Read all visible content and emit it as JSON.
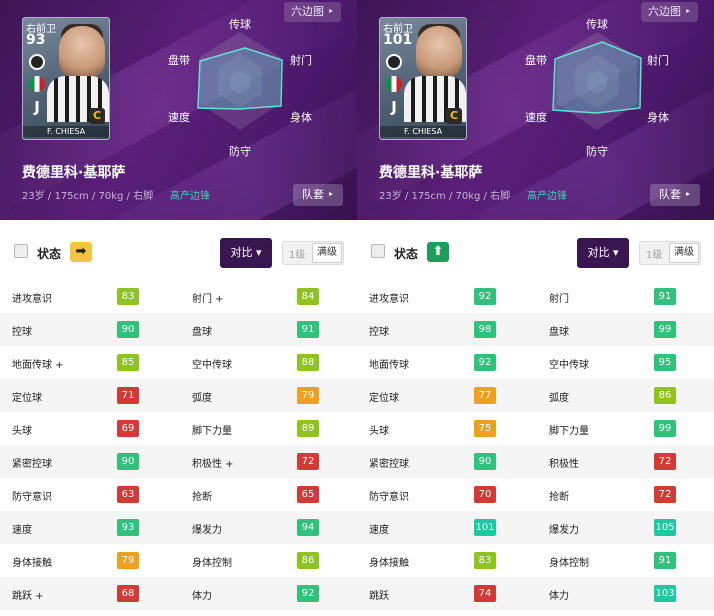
{
  "panels": [
    {
      "card": {
        "position": "右前卫",
        "overall": "93",
        "rating_letter": "C",
        "name": "F. CHIESA"
      },
      "hex_button": "六边图 ‣",
      "radar_labels": {
        "top": "传球",
        "top_right": "射门",
        "bottom_right": "身体",
        "bottom": "防守",
        "bottom_left": "速度",
        "top_left": "盘带"
      },
      "player_name": "费德里科·基耶萨",
      "info": "23岁 / 175cm / 70kg / 右脚",
      "role": "高产边锋",
      "team_button": "队套 ‣",
      "status_label": "状态",
      "status_badge": "➡",
      "compare_button": "对比 ▾",
      "level_low": "1级",
      "level_max": "满级",
      "colors": {
        "status_badge": "#f5c542"
      },
      "stats": [
        {
          "a": "进攻意识",
          "av": "83",
          "b": "射门 +",
          "bv": "84"
        },
        {
          "a": "控球",
          "av": "90",
          "b": "盘球",
          "bv": "91"
        },
        {
          "a": "地面传球 +",
          "av": "85",
          "b": "空中传球",
          "bv": "88"
        },
        {
          "a": "定位球",
          "av": "71",
          "b": "弧度",
          "bv": "79"
        },
        {
          "a": "头球",
          "av": "69",
          "b": "脚下力量",
          "bv": "89"
        },
        {
          "a": "紧密控球",
          "av": "90",
          "b": "积极性 +",
          "bv": "72"
        },
        {
          "a": "防守意识",
          "av": "63",
          "b": "抢断",
          "bv": "65"
        },
        {
          "a": "速度",
          "av": "93",
          "b": "爆发力",
          "bv": "94"
        },
        {
          "a": "身体接触",
          "av": "79",
          "b": "身体控制",
          "bv": "86"
        },
        {
          "a": "跳跃 +",
          "av": "68",
          "b": "体力",
          "bv": "92"
        }
      ]
    },
    {
      "card": {
        "position": "右前卫",
        "overall": "101",
        "rating_letter": "C",
        "name": "F. CHIESA"
      },
      "hex_button": "六边图 ‣",
      "radar_labels": {
        "top": "传球",
        "top_right": "射门",
        "bottom_right": "身体",
        "bottom": "防守",
        "bottom_left": "速度",
        "top_left": "盘带"
      },
      "player_name": "费德里科·基耶萨",
      "info": "23岁 / 175cm / 70kg / 右脚",
      "role": "高产边锋",
      "team_button": "队套 ‣",
      "status_label": "状态",
      "status_badge": "⬆",
      "compare_button": "对比 ▾",
      "level_low": "1级",
      "level_max": "满级",
      "colors": {
        "status_badge": "#1aa05a"
      },
      "stats": [
        {
          "a": "进攻意识",
          "av": "92",
          "b": "射门",
          "bv": "91"
        },
        {
          "a": "控球",
          "av": "98",
          "b": "盘球",
          "bv": "99"
        },
        {
          "a": "地面传球",
          "av": "92",
          "b": "空中传球",
          "bv": "95"
        },
        {
          "a": "定位球",
          "av": "77",
          "b": "弧度",
          "bv": "86"
        },
        {
          "a": "头球",
          "av": "75",
          "b": "脚下力量",
          "bv": "99"
        },
        {
          "a": "紧密控球",
          "av": "90",
          "b": "积极性",
          "bv": "72"
        },
        {
          "a": "防守意识",
          "av": "70",
          "b": "抢断",
          "bv": "72"
        },
        {
          "a": "速度",
          "av": "101",
          "b": "爆发力",
          "bv": "105"
        },
        {
          "a": "身体接触",
          "av": "83",
          "b": "身体控制",
          "bv": "91"
        },
        {
          "a": "跳跃",
          "av": "74",
          "b": "体力",
          "bv": "103"
        }
      ]
    }
  ],
  "stat_colors": {
    "ge100": "#1ec8a0",
    "ge90": "#2fc27a",
    "ge80": "#8fc41e",
    "ge75": "#f0a020",
    "low": "#d43a35"
  }
}
